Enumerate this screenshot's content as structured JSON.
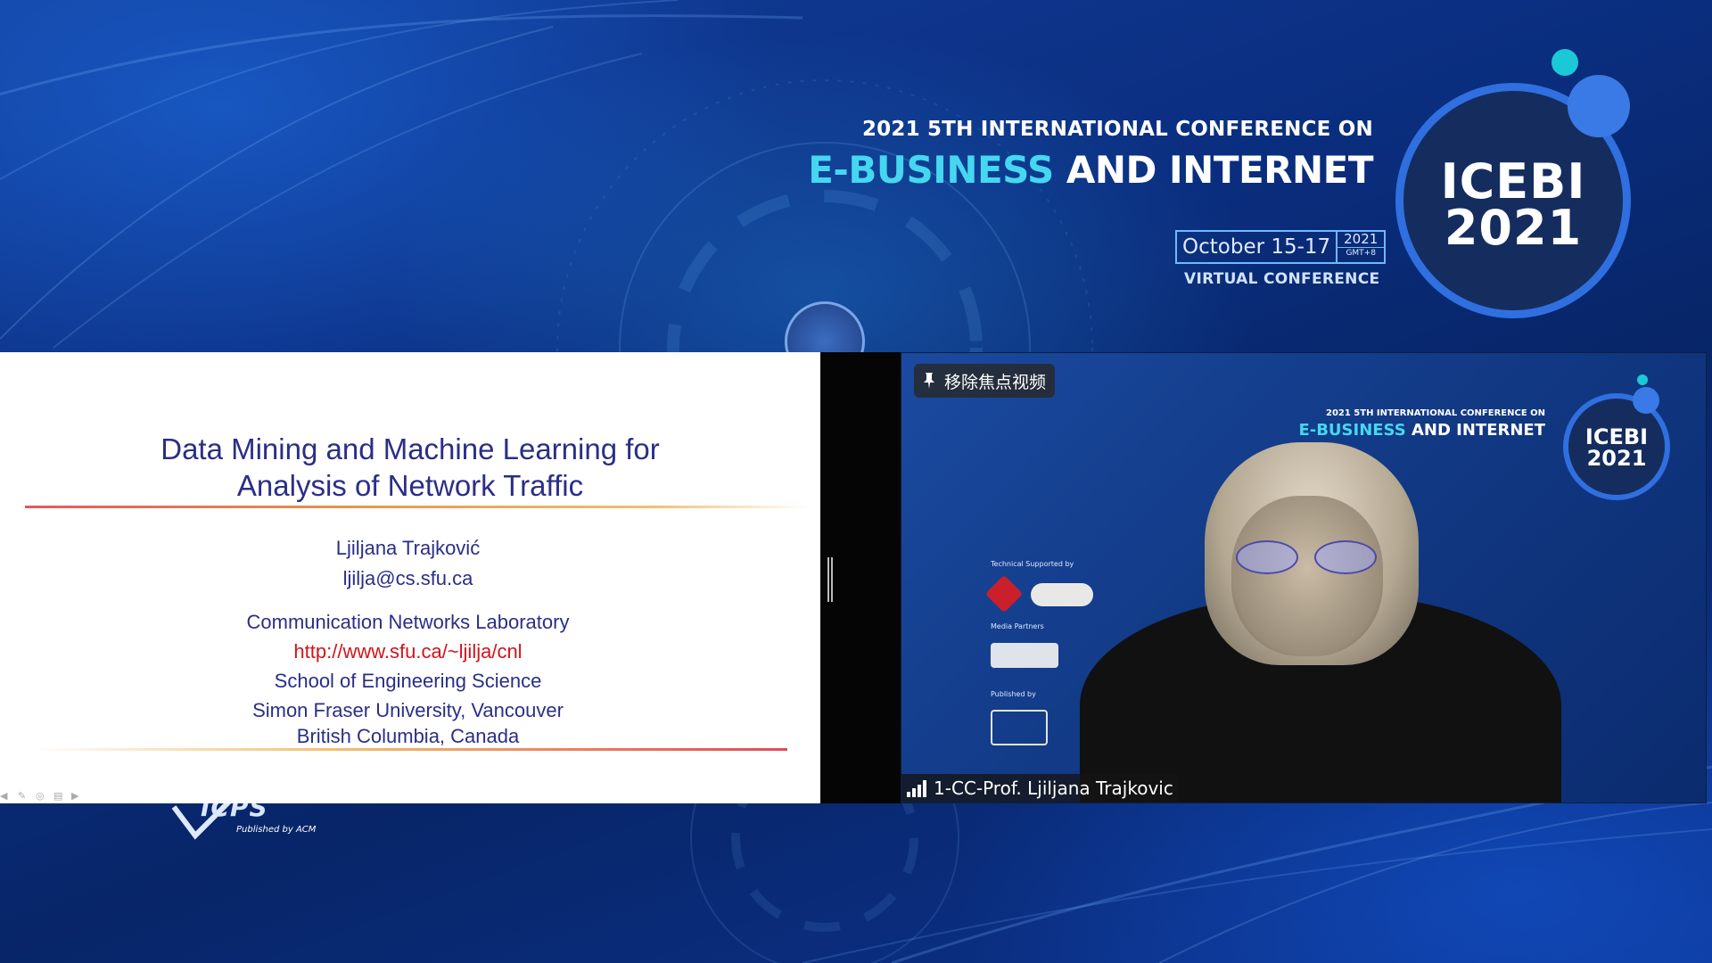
{
  "conference": {
    "line1": "2021 5TH INTERNATIONAL CONFERENCE ON",
    "line2_accent": "E-BUSINESS",
    "line2_rest": " AND INTERNET",
    "dates": "October 15-17",
    "year": "2021",
    "timezone": "GMT+8",
    "type": "VIRTUAL CONFERENCE",
    "logo_line1": "ICEBI",
    "logo_line2": "2021",
    "icps_mark": "ICPS",
    "icps_published": "Published by ACM",
    "colors": {
      "accent": "#46d7f0",
      "ring": "#2f6fe0",
      "background": "#0a2f7a"
    }
  },
  "slide": {
    "title_line1": "Data Mining and Machine Learning for",
    "title_line2": "Analysis of Network Traffic",
    "author": "Ljiljana Trajković",
    "email": "ljilja@cs.sfu.ca",
    "lab": "Communication Networks Laboratory",
    "url": "http://www.sfu.ca/~ljilja/cnl",
    "school": "School of Engineering Science",
    "university": "Simon Fraser University, Vancouver",
    "province": "British Columbia, Canada",
    "colors": {
      "text": "#2b2e86",
      "link": "#d2141a"
    }
  },
  "video": {
    "pin_label": "移除焦点视频",
    "participant_name": "1-CC-Prof. Ljiljana Trajkovic",
    "background_text": {
      "line1": "2021 5TH INTERNATIONAL CONFERENCE ON",
      "line2_accent": "E-BUSINESS",
      "line2_rest": " AND INTERNET",
      "logo_line1": "ICEBI",
      "logo_line2": "2021",
      "tech_supported": "Technical Supported by",
      "media_partners": "Media Partners",
      "published_by": "Published by"
    }
  }
}
